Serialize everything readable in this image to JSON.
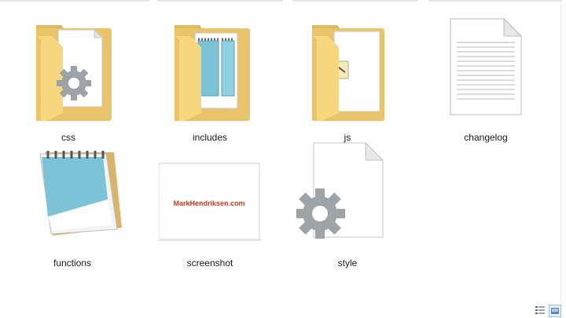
{
  "files": [
    {
      "name": "css",
      "icon": "folder-settings-icon"
    },
    {
      "name": "includes",
      "icon": "folder-notepad-icon"
    },
    {
      "name": "js",
      "icon": "folder-script-icon"
    },
    {
      "name": "changelog",
      "icon": "text-document-icon"
    },
    {
      "name": "functions",
      "icon": "notepad-icon"
    },
    {
      "name": "screenshot",
      "icon": "image-thumbnail-icon",
      "thumbnail_text": "MarkHendriksen.com"
    },
    {
      "name": "style",
      "icon": "settings-file-icon"
    }
  ],
  "statusbar": {
    "views": [
      {
        "name": "details-view",
        "icon": "details-view-icon",
        "selected": false
      },
      {
        "name": "tiles-view",
        "icon": "large-icons-view-icon",
        "selected": true
      }
    ]
  },
  "colors": {
    "folder_back": "#e9c46a",
    "folder_front": "#f6d77e",
    "gear": "#9ea3a8",
    "notepad_blue": "#7cc3d8",
    "brand_red": "#d4371c",
    "brand_blue": "#1e5aa8"
  }
}
